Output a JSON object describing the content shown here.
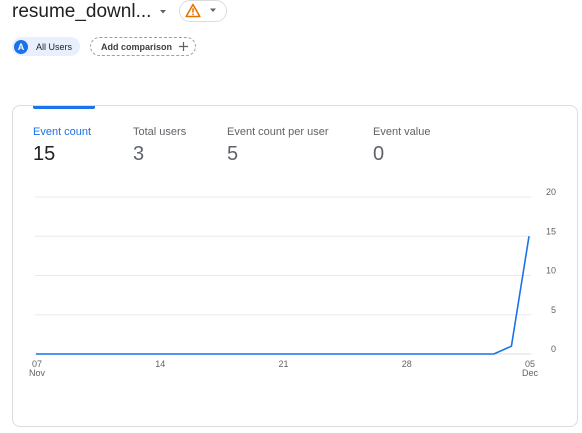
{
  "header": {
    "event_name": "resume_downl...",
    "warning_icon": "warning-triangle-icon",
    "dropdown_icon": "chevron-down-icon"
  },
  "segments": {
    "all_users_avatar": "A",
    "all_users_label": "All Users",
    "add_comparison_label": "Add comparison",
    "add_icon": "plus-icon"
  },
  "metrics": [
    {
      "label": "Event count",
      "value": "15",
      "active": true
    },
    {
      "label": "Total users",
      "value": "3",
      "active": false
    },
    {
      "label": "Event count per user",
      "value": "5",
      "active": false
    },
    {
      "label": "Event value",
      "value": "0",
      "active": false
    }
  ],
  "colors": {
    "accent": "#1a73e8",
    "warning": "#e37400",
    "grid": "#e8eaed"
  },
  "chart_data": {
    "type": "line",
    "series": [
      {
        "values": [
          0,
          0,
          0,
          0,
          0,
          0,
          0,
          0,
          0,
          0,
          0,
          0,
          0,
          0,
          0,
          0,
          0,
          0,
          0,
          0,
          0,
          0,
          0,
          0,
          0,
          0,
          0,
          1,
          15
        ]
      }
    ],
    "x_start_label": "07 Nov",
    "x_ticks": [
      {
        "index": 0,
        "top": "07",
        "bottom": "Nov"
      },
      {
        "index": 7,
        "top": "14",
        "bottom": ""
      },
      {
        "index": 14,
        "top": "21",
        "bottom": ""
      },
      {
        "index": 21,
        "top": "28",
        "bottom": ""
      },
      {
        "index": 28,
        "top": "05",
        "bottom": "Dec"
      }
    ],
    "y_ticks": [
      0,
      5,
      10,
      15,
      20
    ],
    "ylim": [
      0,
      20
    ],
    "y_axis_side": "right",
    "grid": true
  }
}
